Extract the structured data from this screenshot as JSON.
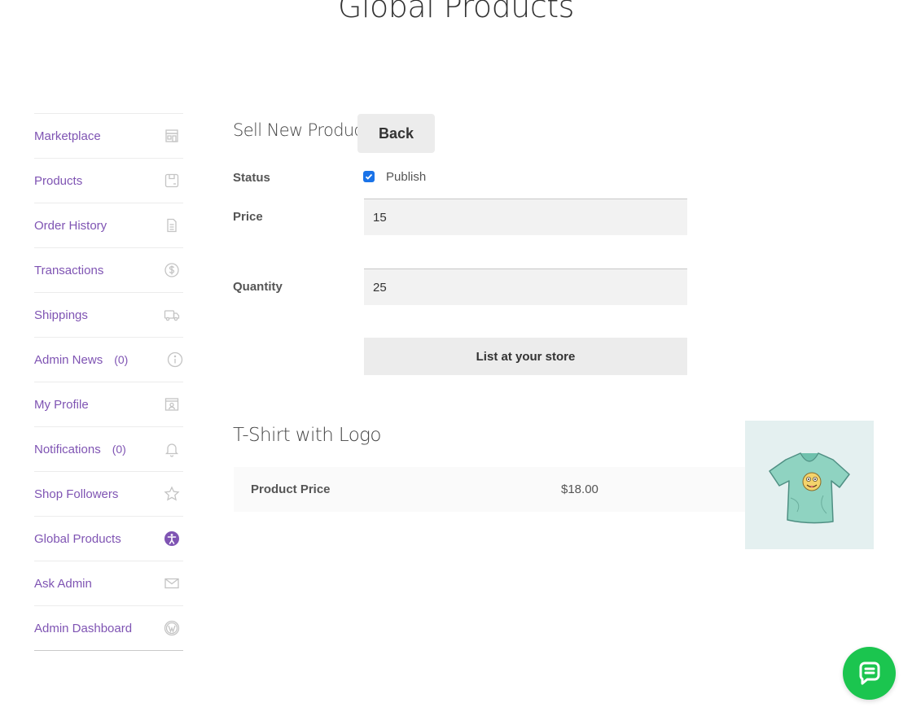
{
  "page": {
    "title": "Global Products"
  },
  "sidebar": {
    "items": [
      {
        "label": "Marketplace",
        "count": "",
        "icon": "store-icon"
      },
      {
        "label": "Products",
        "count": "",
        "icon": "box-icon"
      },
      {
        "label": "Order History",
        "count": "",
        "icon": "document-icon"
      },
      {
        "label": "Transactions",
        "count": "",
        "icon": "dollar-icon"
      },
      {
        "label": "Shippings",
        "count": "",
        "icon": "truck-icon"
      },
      {
        "label": "Admin News",
        "count": "(0)",
        "icon": "info-icon"
      },
      {
        "label": "My Profile",
        "count": "",
        "icon": "profile-icon"
      },
      {
        "label": "Notifications",
        "count": "(0)",
        "icon": "bell-icon"
      },
      {
        "label": "Shop Followers",
        "count": "",
        "icon": "star-icon"
      },
      {
        "label": "Global Products",
        "count": "",
        "icon": "accessibility-icon",
        "active": true
      },
      {
        "label": "Ask Admin",
        "count": "",
        "icon": "envelope-icon"
      },
      {
        "label": "Admin Dashboard",
        "count": "",
        "icon": "wordpress-icon"
      }
    ]
  },
  "form": {
    "title": "Sell New Product",
    "back_label": "Back",
    "status_label": "Status",
    "publish_label": "Publish",
    "publish_checked": true,
    "price_label": "Price",
    "price_value": "15",
    "quantity_label": "Quantity",
    "quantity_value": "25",
    "submit_label": "List at your store"
  },
  "product": {
    "name": "T-Shirt with Logo",
    "price_label": "Product Price",
    "price_value": "$18.00"
  },
  "colors": {
    "accent": "#7f54b3",
    "chat": "#1bc54f",
    "checkbox": "#1a73e8"
  }
}
